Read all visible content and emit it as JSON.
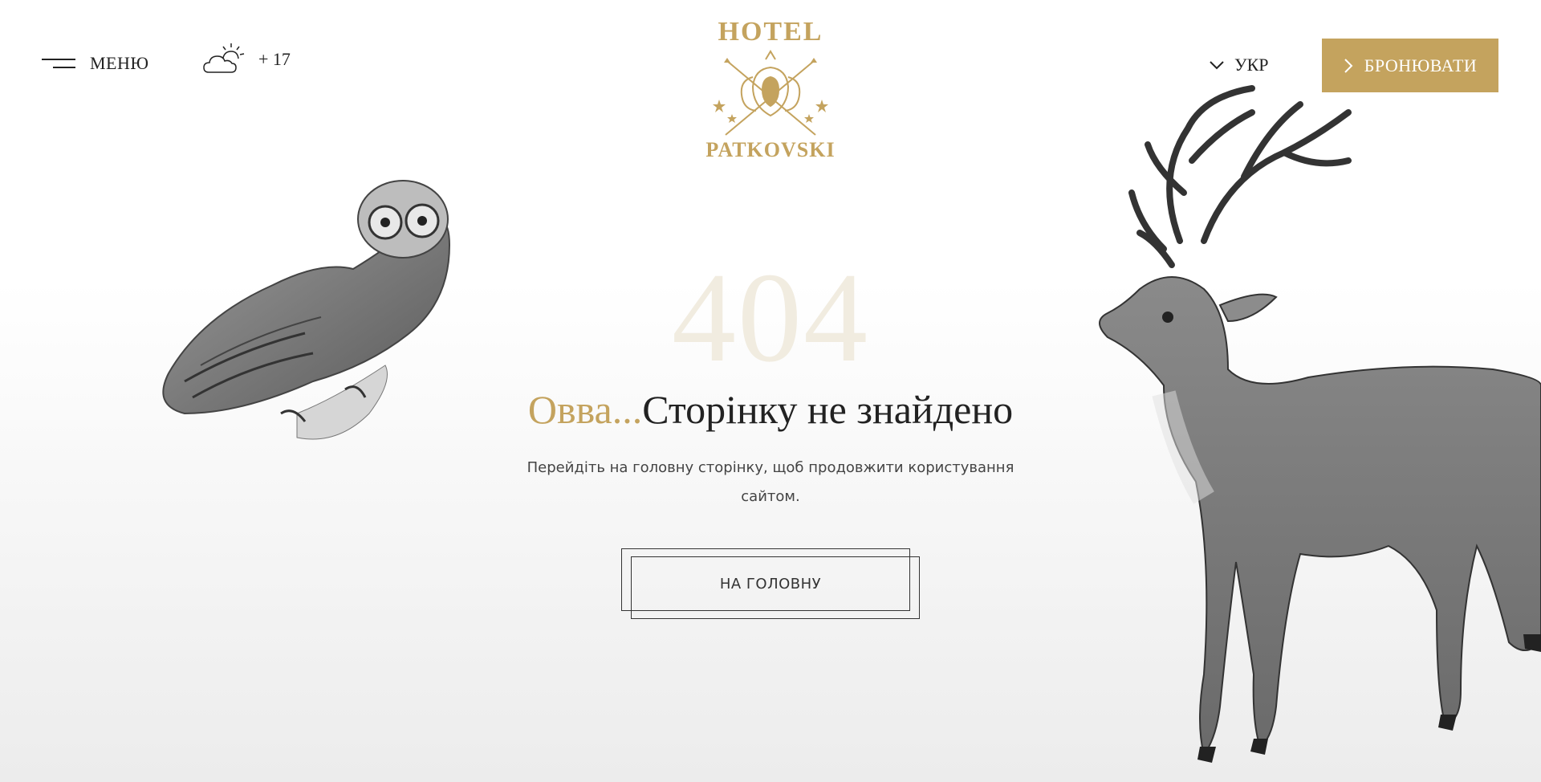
{
  "header": {
    "menu_label": "МЕНЮ",
    "weather_temp": "+ 17",
    "weather_icon": "partly-cloudy-icon",
    "logo_top": "HOTEL",
    "logo_bottom": "PATKOVSKI",
    "lang_label": "УКР",
    "book_label": "БРОНЮВАТИ"
  },
  "main": {
    "code": "404",
    "headline_accent": "Овва...",
    "headline_rest": "Сторінку не знайдено",
    "subtext": "Перейдіть на головну сторінку, щоб продовжити користування сайтом.",
    "home_button": "НА ГОЛОВНУ"
  },
  "colors": {
    "accent": "#c4a35e",
    "code_color": "#f1ece0",
    "text": "#222222"
  }
}
